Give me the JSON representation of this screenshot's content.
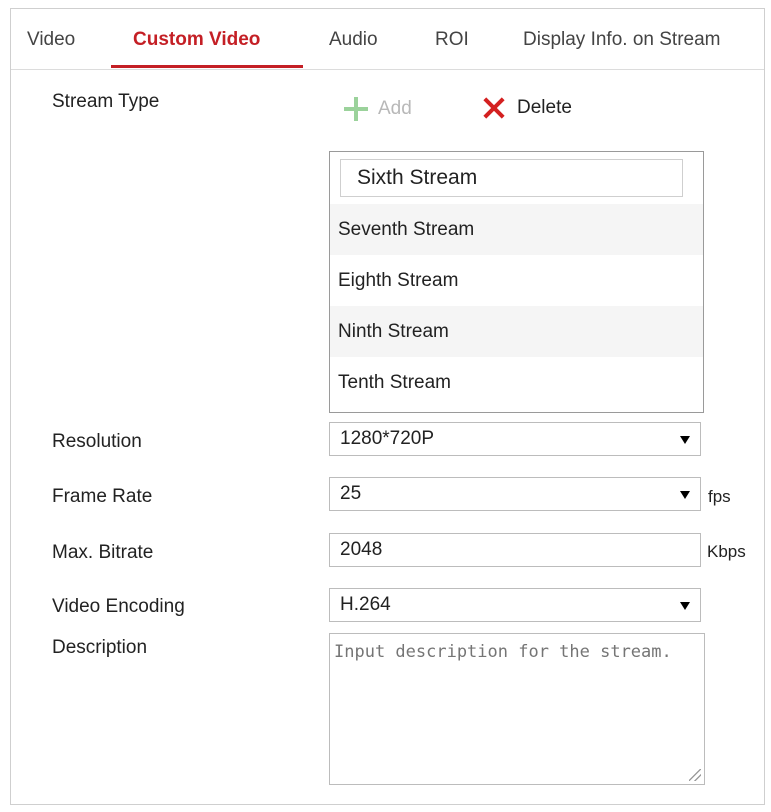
{
  "tabs": [
    {
      "label": "Video",
      "active": false
    },
    {
      "label": "Custom Video",
      "active": true
    },
    {
      "label": "Audio",
      "active": false
    },
    {
      "label": "ROI",
      "active": false
    },
    {
      "label": "Display Info. on Stream",
      "active": false
    }
  ],
  "accent_color": "#c41f25",
  "stream_type": {
    "label": "Stream Type",
    "add_label": "Add",
    "add_icon": "plus-icon",
    "add_enabled": false,
    "delete_label": "Delete",
    "delete_icon": "x-icon",
    "editing_value": "Sixth Stream",
    "streams": [
      "Seventh Stream",
      "Eighth Stream",
      "Ninth Stream",
      "Tenth Stream"
    ]
  },
  "resolution": {
    "label": "Resolution",
    "value": "1280*720P"
  },
  "frame_rate": {
    "label": "Frame Rate",
    "value": "25",
    "unit": "fps"
  },
  "max_bitrate": {
    "label": "Max. Bitrate",
    "value": "2048",
    "unit": "Kbps"
  },
  "video_encoding": {
    "label": "Video Encoding",
    "value": "H.264"
  },
  "description": {
    "label": "Description",
    "placeholder": "Input description for the stream."
  }
}
